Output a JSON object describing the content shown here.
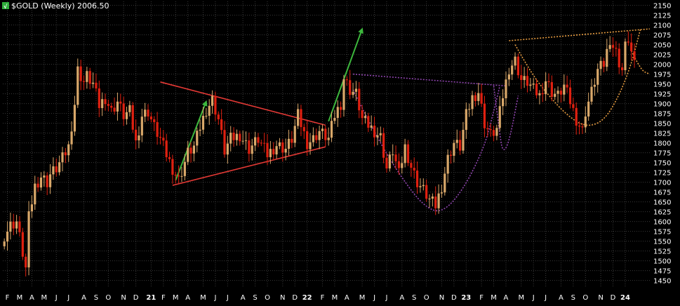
{
  "chart_data": {
    "type": "candlestick",
    "title": "$GOLD (Weekly) 2006.50",
    "title_icon": "sc-logo-icon",
    "ylim": [
      1435,
      2160
    ],
    "y_ticks": [
      1450,
      1475,
      1500,
      1525,
      1550,
      1575,
      1600,
      1625,
      1650,
      1675,
      1700,
      1725,
      1750,
      1775,
      1800,
      1825,
      1850,
      1875,
      1900,
      1925,
      1950,
      1975,
      2000,
      2025,
      2050,
      2075,
      2100,
      2125,
      2150
    ],
    "y_tick_labels": [
      "1450",
      "1475",
      "1500",
      "1525",
      "1550",
      "1575",
      "1600",
      "1625",
      "1650",
      "1675",
      "1700",
      "1725",
      "1750",
      "1775",
      "1800",
      "1825",
      "1850",
      "1875",
      "1900",
      "1925",
      "1950",
      "1975",
      "2000",
      "2025",
      "2050",
      "2075",
      "2100",
      "2125",
      "2150"
    ],
    "last_price": 2006.5,
    "x_ticks": [
      {
        "label": "F",
        "week": 1
      },
      {
        "label": "M",
        "week": 5
      },
      {
        "label": "A",
        "week": 9
      },
      {
        "label": "M",
        "week": 13
      },
      {
        "label": "J",
        "week": 17
      },
      {
        "label": "J",
        "week": 21
      },
      {
        "label": "A",
        "week": 26
      },
      {
        "label": "S",
        "week": 30
      },
      {
        "label": "O",
        "week": 34
      },
      {
        "label": "N",
        "week": 39
      },
      {
        "label": "D",
        "week": 43
      },
      {
        "label": "21",
        "week": 48
      },
      {
        "label": "F",
        "week": 52
      },
      {
        "label": "M",
        "week": 56
      },
      {
        "label": "A",
        "week": 60
      },
      {
        "label": "M",
        "week": 65
      },
      {
        "label": "J",
        "week": 69
      },
      {
        "label": "J",
        "week": 73
      },
      {
        "label": "A",
        "week": 78
      },
      {
        "label": "S",
        "week": 82
      },
      {
        "label": "O",
        "week": 86
      },
      {
        "label": "N",
        "week": 91
      },
      {
        "label": "D",
        "week": 95
      },
      {
        "label": "22",
        "week": 99
      },
      {
        "label": "F",
        "week": 104
      },
      {
        "label": "M",
        "week": 108
      },
      {
        "label": "A",
        "week": 112
      },
      {
        "label": "M",
        "week": 117
      },
      {
        "label": "J",
        "week": 121
      },
      {
        "label": "J",
        "week": 125
      },
      {
        "label": "A",
        "week": 130
      },
      {
        "label": "S",
        "week": 134
      },
      {
        "label": "O",
        "week": 138
      },
      {
        "label": "N",
        "week": 143
      },
      {
        "label": "D",
        "week": 147
      },
      {
        "label": "23",
        "week": 151
      },
      {
        "label": "F",
        "week": 156
      },
      {
        "label": "M",
        "week": 160
      },
      {
        "label": "A",
        "week": 164
      },
      {
        "label": "M",
        "week": 169
      },
      {
        "label": "J",
        "week": 173
      },
      {
        "label": "J",
        "week": 177
      },
      {
        "label": "A",
        "week": 182
      },
      {
        "label": "S",
        "week": 186
      },
      {
        "label": "O",
        "week": 190
      },
      {
        "label": "N",
        "week": 195
      },
      {
        "label": "D",
        "week": 199
      },
      {
        "label": "24",
        "week": 203
      }
    ],
    "anchor_closes": [
      [
        0,
        1565
      ],
      [
        2,
        1590
      ],
      [
        4,
        1600
      ],
      [
        6,
        1520
      ],
      [
        7,
        1480
      ],
      [
        8,
        1610
      ],
      [
        10,
        1690
      ],
      [
        12,
        1715
      ],
      [
        14,
        1700
      ],
      [
        15,
        1720
      ],
      [
        17,
        1735
      ],
      [
        19,
        1760
      ],
      [
        21,
        1790
      ],
      [
        23,
        1900
      ],
      [
        24,
        1985
      ],
      [
        26,
        1955
      ],
      [
        27,
        1970
      ],
      [
        29,
        1950
      ],
      [
        31,
        1895
      ],
      [
        33,
        1915
      ],
      [
        35,
        1880
      ],
      [
        37,
        1905
      ],
      [
        39,
        1870
      ],
      [
        41,
        1880
      ],
      [
        43,
        1800
      ],
      [
        45,
        1870
      ],
      [
        47,
        1880
      ],
      [
        49,
        1840
      ],
      [
        51,
        1810
      ],
      [
        53,
        1770
      ],
      [
        55,
        1735
      ],
      [
        57,
        1705
      ],
      [
        60,
        1775
      ],
      [
        62,
        1790
      ],
      [
        64,
        1840
      ],
      [
        66,
        1885
      ],
      [
        68,
        1910
      ],
      [
        70,
        1860
      ],
      [
        72,
        1780
      ],
      [
        74,
        1810
      ],
      [
        77,
        1820
      ],
      [
        80,
        1785
      ],
      [
        83,
        1810
      ],
      [
        86,
        1770
      ],
      [
        89,
        1795
      ],
      [
        92,
        1785
      ],
      [
        94,
        1810
      ],
      [
        96,
        1870
      ],
      [
        99,
        1800
      ],
      [
        101,
        1810
      ],
      [
        103,
        1830
      ],
      [
        106,
        1810
      ],
      [
        108,
        1870
      ],
      [
        110,
        1900
      ],
      [
        111,
        1965
      ],
      [
        113,
        1935
      ],
      [
        115,
        1925
      ],
      [
        117,
        1860
      ],
      [
        119,
        1845
      ],
      [
        121,
        1830
      ],
      [
        123,
        1815
      ],
      [
        125,
        1735
      ],
      [
        127,
        1780
      ],
      [
        129,
        1720
      ],
      [
        131,
        1790
      ],
      [
        133,
        1740
      ],
      [
        135,
        1700
      ],
      [
        137,
        1680
      ],
      [
        139,
        1655
      ],
      [
        141,
        1640
      ],
      [
        143,
        1690
      ],
      [
        145,
        1760
      ],
      [
        147,
        1800
      ],
      [
        149,
        1790
      ],
      [
        151,
        1870
      ],
      [
        153,
        1915
      ],
      [
        155,
        1930
      ],
      [
        157,
        1850
      ],
      [
        159,
        1820
      ],
      [
        161,
        1835
      ],
      [
        163,
        1920
      ],
      [
        165,
        1990
      ],
      [
        167,
        2010
      ],
      [
        169,
        1960
      ],
      [
        171,
        1955
      ],
      [
        173,
        1935
      ],
      [
        175,
        1920
      ],
      [
        177,
        1960
      ],
      [
        179,
        1930
      ],
      [
        181,
        1920
      ],
      [
        183,
        1945
      ],
      [
        185,
        1905
      ],
      [
        187,
        1860
      ],
      [
        189,
        1830
      ],
      [
        190,
        1880
      ],
      [
        192,
        1930
      ],
      [
        194,
        1985
      ],
      [
        196,
        2000
      ],
      [
        198,
        2065
      ],
      [
        199,
        2045
      ],
      [
        200,
        2030
      ],
      [
        201,
        2005
      ],
      [
        202,
        1985
      ],
      [
        203,
        2045
      ],
      [
        204,
        2065
      ],
      [
        205,
        2030
      ],
      [
        206,
        1995
      ]
    ],
    "annotations": [
      {
        "type": "line",
        "name": "triangle-upper-line",
        "color": "#e53935",
        "points": [
          [
            51,
            1955
          ],
          [
            105,
            1845
          ]
        ]
      },
      {
        "type": "line",
        "name": "triangle-lower-line",
        "color": "#e53935",
        "points": [
          [
            55,
            1692
          ],
          [
            105,
            1790
          ]
        ]
      },
      {
        "type": "arrow",
        "name": "triangle-breakout-arrow-1",
        "color": "#3db83d",
        "points": [
          [
            56,
            1705
          ],
          [
            66,
            1905
          ]
        ]
      },
      {
        "type": "arrow",
        "name": "triangle-breakout-arrow-2",
        "color": "#3db83d",
        "points": [
          [
            106,
            1855
          ],
          [
            117,
            2090
          ]
        ]
      },
      {
        "type": "dotted-line",
        "name": "cup-rim-line",
        "color": "#8e44ad",
        "points": [
          [
            114,
            1975
          ],
          [
            164,
            1945
          ]
        ]
      },
      {
        "type": "dotted-curve",
        "name": "cup-curve",
        "color": "#8e44ad",
        "points": [
          [
            114,
            1935
          ],
          [
            122,
            1810
          ],
          [
            130,
            1710
          ],
          [
            137,
            1640
          ],
          [
            143,
            1620
          ],
          [
            150,
            1680
          ],
          [
            157,
            1790
          ],
          [
            160,
            1880
          ],
          [
            162,
            1945
          ]
        ]
      },
      {
        "type": "dotted-curve",
        "name": "handle-curve",
        "color": "#8e44ad",
        "points": [
          [
            160,
            1945
          ],
          [
            162,
            1820
          ],
          [
            163,
            1775
          ],
          [
            165,
            1800
          ],
          [
            168,
            1920
          ]
        ]
      },
      {
        "type": "dotted-line",
        "name": "inverse-hs-neckline",
        "color": "#e59b40",
        "points": [
          [
            165,
            2060
          ],
          [
            211,
            2090
          ]
        ]
      },
      {
        "type": "dotted-curve",
        "name": "inverse-hs-right-curve",
        "color": "#e59b40",
        "points": [
          [
            167,
            2050
          ],
          [
            172,
            1980
          ],
          [
            178,
            1920
          ],
          [
            184,
            1870
          ],
          [
            190,
            1840
          ],
          [
            196,
            1855
          ],
          [
            201,
            1920
          ],
          [
            205,
            2000
          ],
          [
            208,
            2090
          ]
        ]
      },
      {
        "type": "dotted-curve",
        "name": "inverse-hs-left-curve",
        "color": "#e59b40",
        "points": [
          [
            205,
            2035
          ],
          [
            208,
            1985
          ],
          [
            211,
            1975
          ]
        ]
      }
    ],
    "colors": {
      "background": "#000000",
      "grid": "#3a3a3a",
      "up_candle": "#d9a86a",
      "down_candle": "#e02010",
      "axis_text": "#ffffff",
      "title_text": "#ffffff"
    }
  }
}
